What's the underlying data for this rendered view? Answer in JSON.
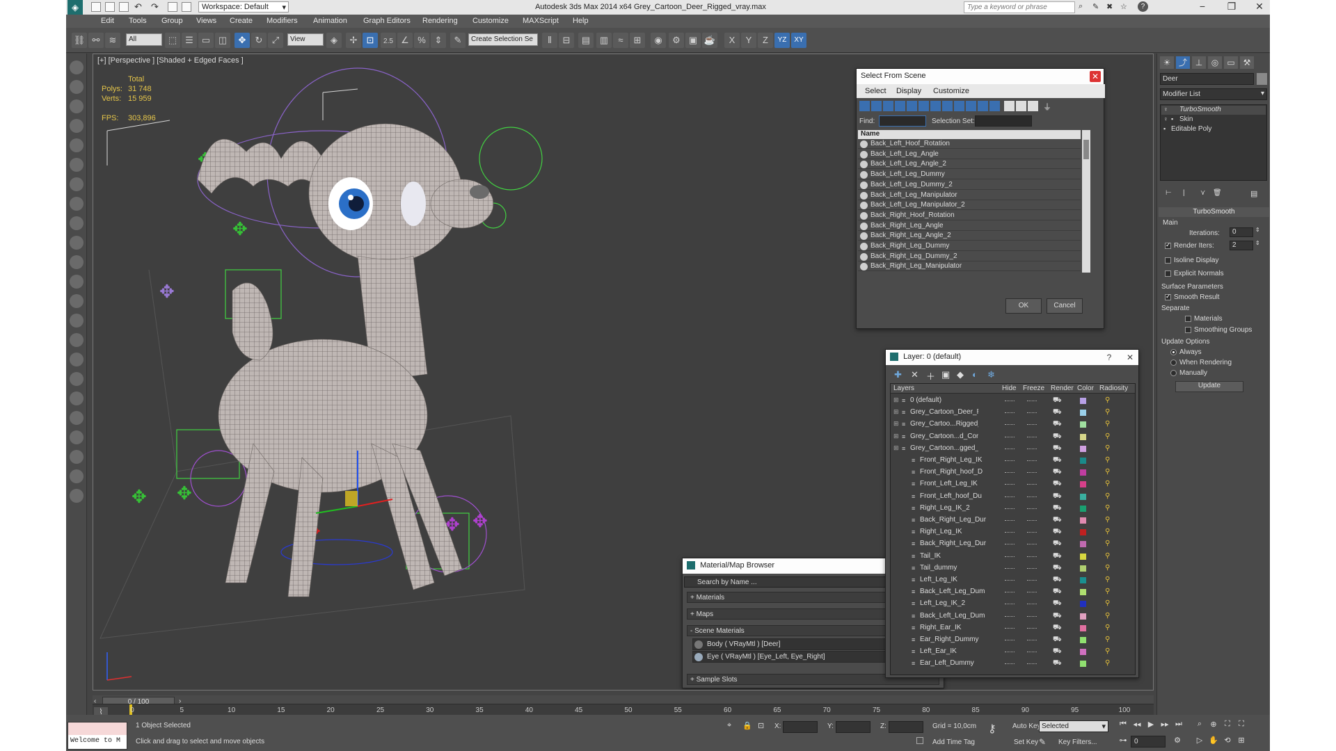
{
  "window": {
    "title": "Autodesk 3ds Max  2014 x64     Grey_Cartoon_Deer_Rigged_vray.max",
    "workspace": "Workspace: Default",
    "search_placeholder": "Type a keyword or phrase"
  },
  "menu": [
    "Edit",
    "Tools",
    "Group",
    "Views",
    "Create",
    "Modifiers",
    "Animation",
    "Graph Editors",
    "Rendering",
    "Customize",
    "MAXScript",
    "Help"
  ],
  "toolbar": {
    "filter": "All",
    "ref_coord": "View",
    "num1": "2.5",
    "snap_label": "%",
    "named_sel": "Create Selection Se",
    "axes": [
      "X",
      "Y",
      "Z",
      "YZ",
      "XY"
    ]
  },
  "viewport": {
    "label": "[+] [Perspective ] [Shaded + Edged Faces ]",
    "stats": {
      "total": "Total",
      "polys_label": "Polys:",
      "polys": "31 748",
      "verts_label": "Verts:",
      "verts": "15 959",
      "fps_label": "FPS:",
      "fps": "303,896"
    }
  },
  "select_dialog": {
    "title": "Select From Scene",
    "menus": [
      "Select",
      "Display",
      "Customize"
    ],
    "find_label": "Find:",
    "selset_label": "Selection Set:",
    "col_name": "Name",
    "items": [
      "Back_Left_Hoof_Rotation",
      "Back_Left_Leg_Angle",
      "Back_Left_Leg_Angle_2",
      "Back_Left_Leg_Dummy",
      "Back_Left_Leg_Dummy_2",
      "Back_Left_Leg_Manipulator",
      "Back_Left_Leg_Manipulator_2",
      "Back_Right_Hoof_Rotation",
      "Back_Right_Leg_Angle",
      "Back_Right_Leg_Angle_2",
      "Back_Right_Leg_Dummy",
      "Back_Right_Leg_Dummy_2",
      "Back_Right_Leg_Manipulator"
    ],
    "ok": "OK",
    "cancel": "Cancel"
  },
  "layer_dialog": {
    "title": "Layer: 0 (default)",
    "headers": [
      "Layers",
      "Hide",
      "Freeze",
      "Render",
      "Color",
      "Radiosity"
    ],
    "rows": [
      {
        "name": "0 (default)",
        "color": "#b7a0e6",
        "indent": 0
      },
      {
        "name": "Grey_Cartoon_Deer_Ri",
        "color": "#9ad0ea",
        "indent": 0
      },
      {
        "name": "Grey_Cartoo...Rigged_",
        "color": "#a0e0a0",
        "indent": 0
      },
      {
        "name": "Grey_Cartoon...d_Cont",
        "color": "#d6d68a",
        "indent": 0
      },
      {
        "name": "Grey_Cartoon...gged_I",
        "color": "#cfa0e0",
        "indent": 0
      },
      {
        "name": "Front_Right_Leg_IK",
        "color": "#1a8a8a",
        "indent": 1
      },
      {
        "name": "Front_Right_hoof_D",
        "color": "#c03da0",
        "indent": 1
      },
      {
        "name": "Front_Left_Leg_IK",
        "color": "#d6408a",
        "indent": 1
      },
      {
        "name": "Front_Left_hoof_Du",
        "color": "#3ab0a0",
        "indent": 1
      },
      {
        "name": "Right_Leg_IK_2",
        "color": "#1aa070",
        "indent": 1
      },
      {
        "name": "Back_Right_Leg_Dur",
        "color": "#e08ab0",
        "indent": 1
      },
      {
        "name": "Right_Leg_IK",
        "color": "#c02020",
        "indent": 1
      },
      {
        "name": "Back_Right_Leg_Dur",
        "color": "#c06ab0",
        "indent": 1
      },
      {
        "name": "Tail_IK",
        "color": "#d6d640",
        "indent": 1
      },
      {
        "name": "Tail_dummy",
        "color": "#b0d070",
        "indent": 1
      },
      {
        "name": "Left_Leg_IK",
        "color": "#1a9090",
        "indent": 1
      },
      {
        "name": "Back_Left_Leg_Dum",
        "color": "#b0e070",
        "indent": 1
      },
      {
        "name": "Left_Leg_IK_2",
        "color": "#2030c0",
        "indent": 1
      },
      {
        "name": "Back_Left_Leg_Dum",
        "color": "#e0a0c0",
        "indent": 1
      },
      {
        "name": "Right_Ear_IK",
        "color": "#e070a0",
        "indent": 1
      },
      {
        "name": "Ear_Right_Dummy",
        "color": "#90e070",
        "indent": 1
      },
      {
        "name": "Left_Ear_IK",
        "color": "#d070c0",
        "indent": 1
      },
      {
        "name": "Ear_Left_Dummy",
        "color": "#90e070",
        "indent": 1
      }
    ]
  },
  "material_browser": {
    "title": "Material/Map Browser",
    "search": "Search by Name ...",
    "sections": [
      "+ Materials",
      "+ Maps",
      "- Scene Materials"
    ],
    "scene_materials": [
      "Body  ( VRayMtl ) [Deer]",
      "Eye  ( VRayMtl ) [Eye_Left, Eye_Right]"
    ],
    "sample_slots": "+ Sample Slots"
  },
  "command_panel": {
    "object_name": "Deer",
    "modifier_list": "Modifier List",
    "stack": [
      "TurboSmooth",
      "Skin",
      "Editable Poly"
    ],
    "turbosmooth": {
      "title": "TurboSmooth",
      "main": "Main",
      "iterations_label": "Iterations:",
      "iterations": "0",
      "render_iters_label": "Render Iters:",
      "render_iters": "2",
      "isoline": "Isoline Display",
      "explicit": "Explicit Normals",
      "surface": "Surface Parameters",
      "smooth_result": "Smooth Result",
      "separate": "Separate",
      "materials": "Materials",
      "smoothing": "Smoothing Groups",
      "update_options": "Update Options",
      "always": "Always",
      "when_rendering": "When Rendering",
      "manually": "Manually",
      "update": "Update"
    }
  },
  "timeline": {
    "frame": "0 / 100",
    "ticks": [
      "0",
      "5",
      "10",
      "15",
      "20",
      "25",
      "30",
      "35",
      "40",
      "45",
      "50",
      "55",
      "60",
      "65",
      "70",
      "75",
      "80",
      "85",
      "90",
      "95",
      "100"
    ]
  },
  "status": {
    "selected": "1 Object Selected",
    "prompt": "Click and drag to select and move objects",
    "listener": "Welcome to M",
    "x_label": "X:",
    "y_label": "Y:",
    "z_label": "Z:",
    "grid": "Grid = 10,0cm",
    "add_time_tag": "Add Time Tag",
    "auto_key": "Auto Key",
    "set_key": "Set Key",
    "selected_dd": "Selected",
    "key_filters": "Key Filters...",
    "frame_field": "0"
  },
  "colors": {
    "bg": "#444444",
    "accent": "#3a6fb0",
    "stats": "#e6c64a"
  }
}
